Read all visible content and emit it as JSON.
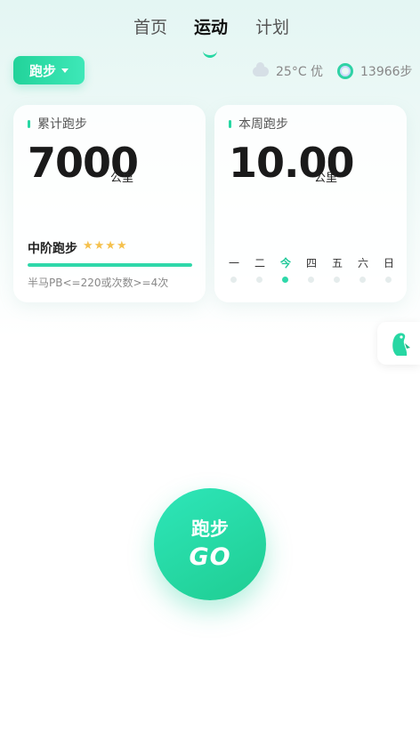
{
  "tabs": [
    {
      "label": "首页",
      "active": false
    },
    {
      "label": "运动",
      "active": true
    },
    {
      "label": "计划",
      "active": false
    }
  ],
  "sport_selector": {
    "label": "跑步"
  },
  "weather": {
    "icon": "cloud-icon",
    "temp": "25°C",
    "quality": "优",
    "text": "25°C 优"
  },
  "steps": {
    "icon": "step-ring-icon",
    "count": "13966步"
  },
  "total_card": {
    "title": "累计跑步",
    "value": "7000",
    "unit": "公里",
    "level": "中阶跑步",
    "stars": "★★★★",
    "star_count": 4,
    "progress": 1.0,
    "note": "半马PB<=220或次数>=4次"
  },
  "week_card": {
    "title": "本周跑步",
    "value": "10.00",
    "unit": "公里",
    "days": [
      {
        "label": "一",
        "today": false
      },
      {
        "label": "二",
        "today": false
      },
      {
        "label": "今",
        "today": true
      },
      {
        "label": "四",
        "today": false
      },
      {
        "label": "五",
        "today": false
      },
      {
        "label": "六",
        "today": false
      },
      {
        "label": "日",
        "today": false
      }
    ]
  },
  "side_button": {
    "icon": "penguin-icon"
  },
  "go_button": {
    "label": "跑步",
    "sub_label": "GO"
  },
  "colors": {
    "accent": "#27d7a3",
    "star": "#f5c14d"
  }
}
